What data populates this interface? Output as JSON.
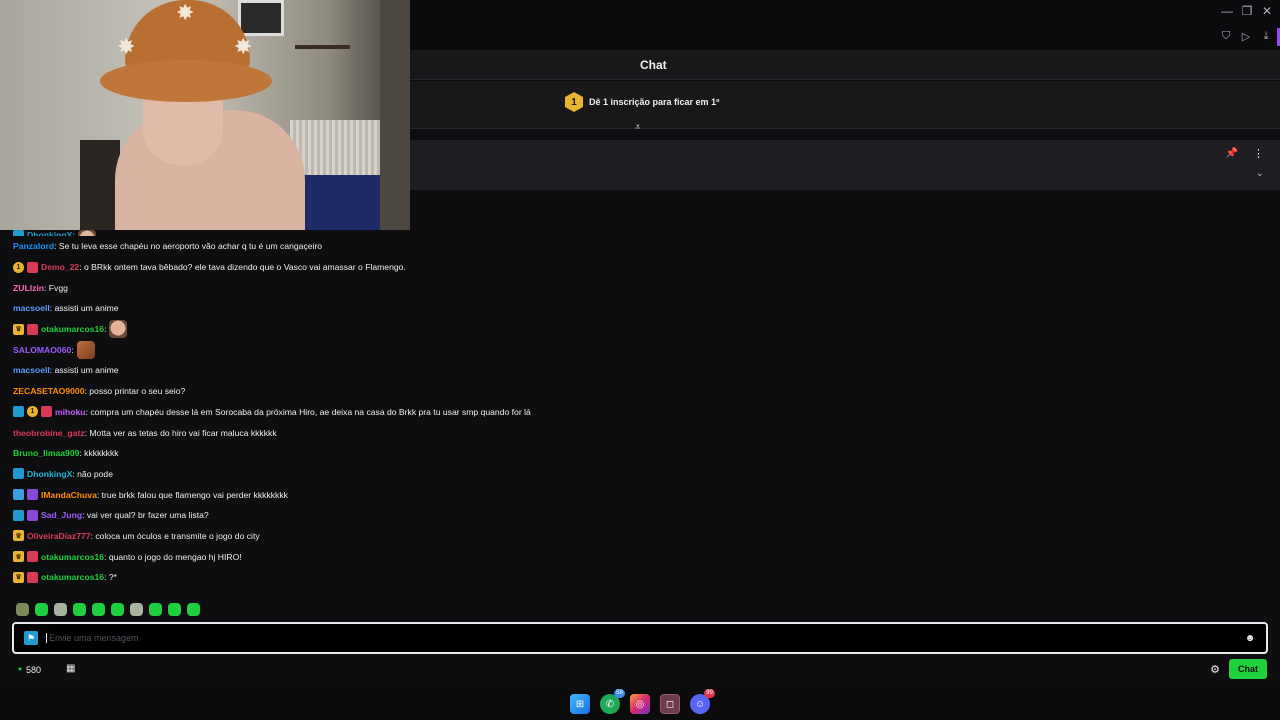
{
  "window": {
    "minimize_icon": "minimize-icon",
    "restore_icon": "restore-icon",
    "close_icon": "close-icon"
  },
  "toolbar": {
    "icons": [
      "shield-icon",
      "send-icon",
      "download-icon"
    ]
  },
  "chat": {
    "title": "Chat",
    "leaderboard": {
      "rank": "1",
      "text": "Dê 1 inscrição para ficar em 1º"
    }
  },
  "messages": [
    {
      "user": "DhonkingX:",
      "color": "#1f9bd1",
      "text": "",
      "badges": [
        "b-blue"
      ],
      "emote": "face",
      "partial": true
    },
    {
      "user": "Panzalord",
      "color": "#1e90ff",
      "text": ": Se tu leva esse chapéu no aeroporto vão achar q tu é um cangaçeiro",
      "badges": []
    },
    {
      "user": "Demo_22",
      "color": "#d93a56",
      "text": ": o BRkk ontem tava bêbado? ele tava dizendo que o Vasco vai amassar o Flamengo.",
      "badges": [
        "b-gold",
        "b-red"
      ]
    },
    {
      "user": "ZULIzin",
      "color": "#ff69b4",
      "text": ": Fvgg",
      "badges": []
    },
    {
      "user": "macsoell",
      "color": "#5b9bff",
      "text": ": assisti um anime",
      "badges": []
    },
    {
      "user": "otakumarcos16",
      "color": "#1fd13a",
      "text": ":",
      "badges": [
        "b-crown",
        "b-red"
      ],
      "emote": "face"
    },
    {
      "user": "SALOMAO060",
      "color": "#9b5cff",
      "text": ":",
      "badges": [],
      "emote": "box"
    },
    {
      "user": "macsoell",
      "color": "#5b9bff",
      "text": ": assisti um anime",
      "badges": []
    },
    {
      "user": "ZECASETAO9000",
      "color": "#ff8c00",
      "text": ": posso printar o seu seio?",
      "badges": []
    },
    {
      "user": "mihoku",
      "color": "#c060ff",
      "text": ": compra um chapéu desse lá em Sorocaba da próxima Hiro, ae deixa na casa do Brkk pra tu usar smp quando for lá",
      "badges": [
        "b-blue",
        "b-gold",
        "b-red"
      ]
    },
    {
      "user": "theobrobine_gatz",
      "color": "#d93a56",
      "text": ": Motta ver as tetas do hiro vai ficar maluca kkkkkk",
      "badges": []
    },
    {
      "user": "Bruno_limaa909",
      "color": "#1fd13a",
      "text": ": kkkkkkkk",
      "badges": []
    },
    {
      "user": "DhonkingX",
      "color": "#1fb5d9",
      "text": ": não pode",
      "badges": [
        "b-blue"
      ]
    },
    {
      "user": "IMandaChuva",
      "color": "#ff8c00",
      "text": ": true brkk falou que flamengo vai perder kkkkkkkk",
      "badges": [
        "b-sky",
        "b-purple"
      ]
    },
    {
      "user": "Sad_Jung",
      "color": "#9b5cff",
      "text": ": vai ver qual? br fazer uma lista?",
      "badges": [
        "b-blue",
        "b-purple"
      ]
    },
    {
      "user": "OliveiraDiaz777",
      "color": "#d93a56",
      "text": ": coloca um óculos e transmite o jogo do city",
      "badges": [
        "b-crown"
      ]
    },
    {
      "user": "otakumarcos16",
      "color": "#1fd13a",
      "text": ": quanto o jogo do mengao hj HIRO!",
      "badges": [
        "b-crown",
        "b-red"
      ]
    },
    {
      "user": "otakumarcos16",
      "color": "#1fd13a",
      "text": ": ?*",
      "badges": [
        "b-crown",
        "b-red"
      ]
    }
  ],
  "input": {
    "placeholder": "Envie uma mensagem",
    "value": ""
  },
  "bottom": {
    "points": "580",
    "chat_button": "Chat"
  },
  "taskbar": {
    "whatsapp_badge": "58",
    "discord_badge": "99"
  },
  "colors": {
    "accent": "#1fd13a",
    "background": "#0e0e10",
    "brand_purple": "#9147ff"
  }
}
